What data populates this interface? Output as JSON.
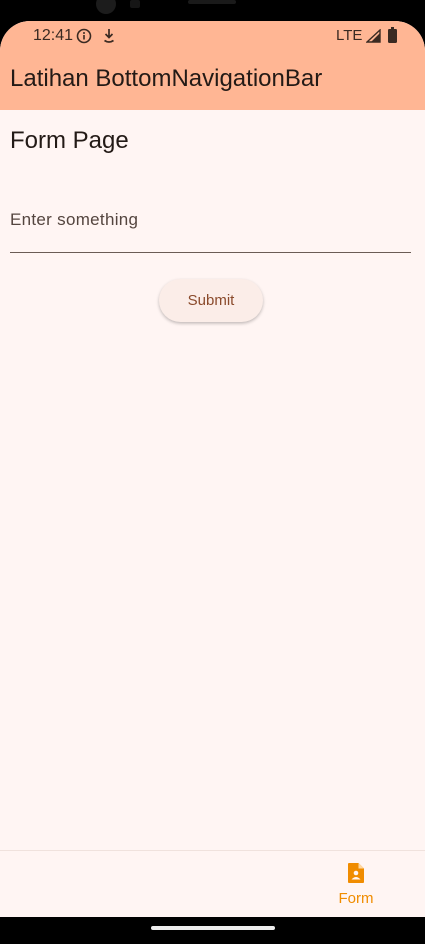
{
  "status_bar": {
    "time": "12:41",
    "network": "LTE",
    "icons": [
      "info-icon",
      "download-icon",
      "signal-icon",
      "battery-icon"
    ]
  },
  "app_bar": {
    "title": "Latihan BottomNavigationBar",
    "background_color": "#ffb694"
  },
  "main": {
    "heading": "Form Page",
    "input": {
      "label": "Enter something",
      "value": ""
    },
    "submit_label": "Submit"
  },
  "bottom_nav": {
    "items": [
      {
        "label": "Form",
        "icon": "contact-document-icon",
        "selected": true
      }
    ],
    "selected_color": "#f08c00"
  },
  "colors": {
    "background": "#fff5f3",
    "accent": "#ffb694",
    "button_text": "#8a4a2b"
  }
}
